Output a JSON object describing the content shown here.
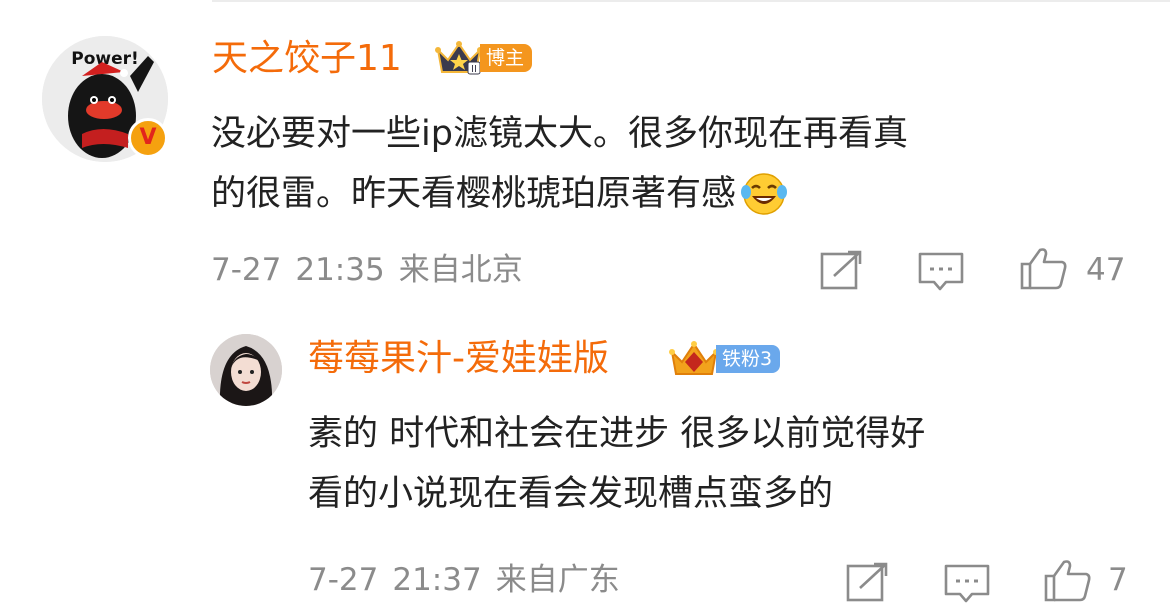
{
  "comment": {
    "author": "天之饺子11",
    "role_badge": "博主",
    "avatar_text": "Power!",
    "verified_mark": "V",
    "content_lines": [
      "没必要对一些ip滤镜太大。很多你现在再看真",
      "的很雷。昨天看樱桃琥珀原著有感"
    ],
    "emoji": "laughing-crying-emoji",
    "date": "7-27",
    "time": "21:35",
    "location": "来自北京",
    "likes": "47"
  },
  "reply": {
    "author": "莓莓果汁-爱娃娃版",
    "fan_badge": "铁粉3",
    "content_lines": [
      "素的 时代和社会在进步 很多以前觉得好",
      "看的小说现在看会发现槽点蛮多的"
    ],
    "date": "7-27",
    "time": "21:37",
    "location": "来自广东",
    "likes": "7"
  },
  "colors": {
    "name": "#f46b0a",
    "meta": "#8b8b8b",
    "text": "#222222",
    "blogger_badge": "#f4961e",
    "fan_badge": "#6aa8ec"
  },
  "icons": [
    "repost-icon",
    "comment-icon",
    "like-icon",
    "crown-icon"
  ]
}
